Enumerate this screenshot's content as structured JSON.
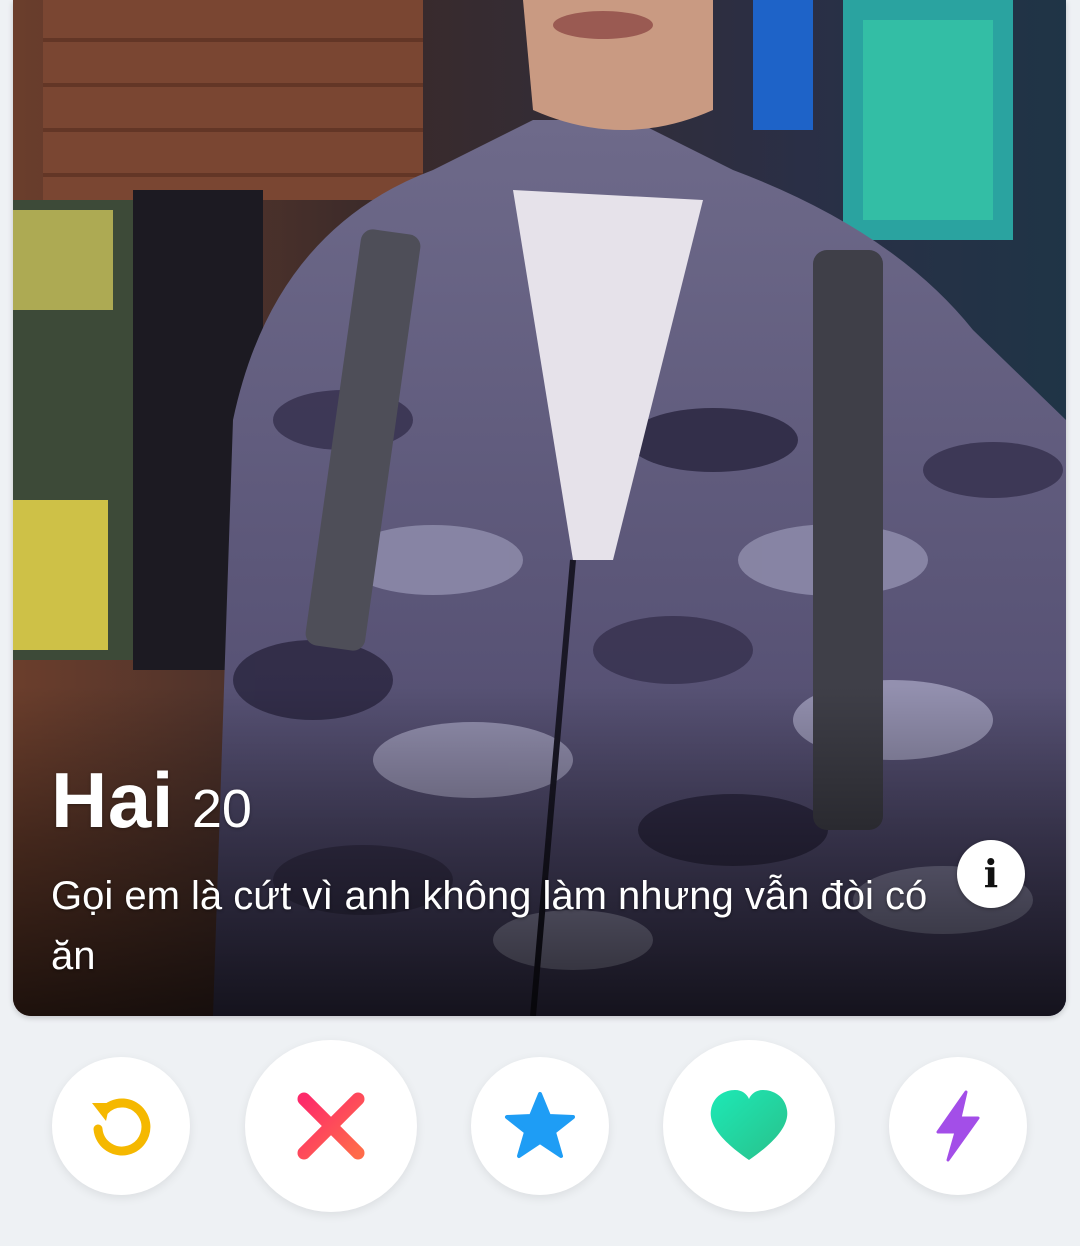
{
  "profile": {
    "name": "Hai",
    "age": "20",
    "bio": "Gọi em là cứt vì anh không làm nhưng vẫn đòi có ăn"
  },
  "icons": {
    "info": "info-icon",
    "rewind": "rewind-icon",
    "nope": "close-icon",
    "super_like": "star-icon",
    "like": "heart-icon",
    "boost": "lightning-icon"
  },
  "colors": {
    "rewind": "#f5b800",
    "nope": "#fd4e68",
    "super_like": "#1e9df5",
    "like": "#1fd8a3",
    "boost": "#a34ee8",
    "background": "#eef1f4"
  }
}
